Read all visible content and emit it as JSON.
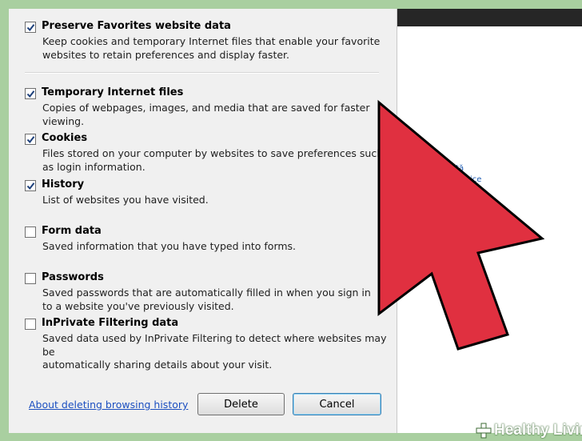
{
  "dialog": {
    "items": [
      {
        "title": "Preserve Favorites website data",
        "checked": true,
        "desc": [
          "Keep cookies and temporary Internet files that enable your favorite",
          "websites to retain preferences and display faster."
        ]
      },
      {
        "title": "Temporary Internet files",
        "checked": true,
        "desc": [
          "Copies of webpages, images, and media that are saved for faster",
          "viewing."
        ]
      },
      {
        "title": "Cookies",
        "checked": true,
        "desc": [
          "Files stored on your computer by websites to save preferences such",
          "as login information."
        ]
      },
      {
        "title": "History",
        "checked": true,
        "desc": [
          "List of websites you have visited."
        ]
      },
      {
        "title": "Form data",
        "checked": false,
        "desc": [
          "Saved information that you have typed into forms."
        ]
      },
      {
        "title": "Passwords",
        "checked": false,
        "desc": [
          "Saved passwords that are automatically filled in when you sign in",
          "to a website you've previously visited."
        ]
      },
      {
        "title": "InPrivate Filtering data",
        "checked": false,
        "desc": [
          "Saved data used by InPrivate Filtering to detect where websites may be",
          "automatically sharing details about your visit."
        ]
      }
    ],
    "link": "About deleting browsing history",
    "delete_label": "Delete",
    "cancel_label": "Cancel"
  },
  "background_window": {
    "fragments": [
      "ată",
      "evistice"
    ]
  },
  "watermark": {
    "text": "Healthy Living"
  },
  "colors": {
    "cursor": "#e03040",
    "page_bg": "#a9cfa0",
    "link": "#1b4fc0"
  }
}
